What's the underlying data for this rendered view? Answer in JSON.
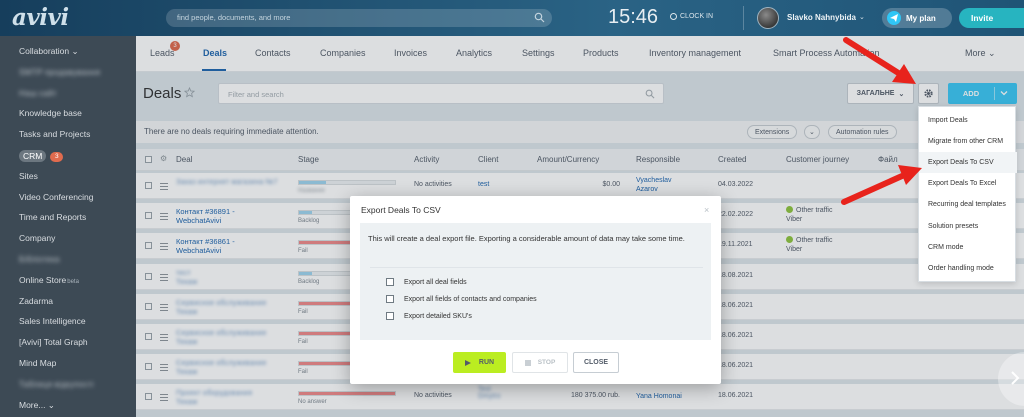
{
  "topbar": {
    "logo": "avivi",
    "search_placeholder": "find people, documents, and more",
    "clock": "15:46",
    "clock_in": "CLOCK IN",
    "username": "Slavko Nahnybida",
    "my_plan": "My plan",
    "invite": "Invite"
  },
  "sidebar": {
    "items": [
      {
        "label": "Collaboration ⌄",
        "blur": false
      },
      {
        "label": "SMTP продавування",
        "blur": true
      },
      {
        "label": "Наш сайт",
        "blur": true
      },
      {
        "label": "Knowledge base",
        "blur": false
      },
      {
        "label": "Tasks and Projects",
        "blur": false
      },
      {
        "label": "CRM",
        "badge": "3",
        "blur": false
      },
      {
        "label": "Sites",
        "blur": false
      },
      {
        "label": "Video Conferencing",
        "blur": false
      },
      {
        "label": "Time and Reports",
        "blur": false
      },
      {
        "label": "Company",
        "blur": false
      },
      {
        "label": "Бібліотека",
        "blur": true
      },
      {
        "label": "Online Store",
        "sup": "beta",
        "blur": false
      },
      {
        "label": "Zadarma",
        "blur": false
      },
      {
        "label": "Sales Intelligence",
        "blur": false
      },
      {
        "label": "[Avivi] Total Graph",
        "blur": false
      },
      {
        "label": "Mind Map",
        "blur": false
      },
      {
        "label": "Таблиця відкупості",
        "blur": true
      },
      {
        "label": "More... ⌄",
        "blur": false
      }
    ]
  },
  "tabs": {
    "items": [
      "Leads",
      "Deals",
      "Contacts",
      "Companies",
      "Invoices",
      "Analytics",
      "Settings",
      "Products",
      "Inventory management",
      "Smart Process Automation",
      "More ⌄"
    ],
    "leads_badge": "3"
  },
  "toolbar": {
    "title": "Deals",
    "filter_placeholder": "Filter and search",
    "category_button": "ЗАГАЛЬНЕ",
    "add_button": "ADD"
  },
  "infobar": {
    "message": "There are no deals requiring immediate attention.",
    "extensions": "Extensions",
    "automation_rules": "Automation rules"
  },
  "table": {
    "headers": [
      "Deal",
      "Stage",
      "Activity",
      "Client",
      "Amount/Currency",
      "Responsible",
      "Created",
      "Customer journey",
      "Файл"
    ],
    "rows": [
      {
        "deal": "Заказ интернет магазина №7",
        "deal_blur": true,
        "stage_color": "#9fd4ef",
        "stage_pct": 0.28,
        "stage_label": "Название",
        "stage_blur": true,
        "activity": "No activities",
        "client": "test",
        "client_blur": false,
        "amount": "$0.00",
        "responsible": "Vyacheslav\nAzarov",
        "responsible_blur": false,
        "created": "04.03.2022",
        "journey": ""
      },
      {
        "deal": "Контакт #36891 -\nWebchatAvivi",
        "deal_blur": false,
        "stage_color": "#9fd4ef",
        "stage_pct": 0.14,
        "stage_label": "Backlog",
        "stage_blur": false,
        "activity": "",
        "client": "",
        "client_blur": false,
        "amount": "",
        "responsible": "",
        "responsible_blur": false,
        "created": "22.02.2022",
        "journey": "Other traffic\nViber"
      },
      {
        "deal": "Контакт #36861 -\nWebchatAvivi",
        "deal_blur": false,
        "stage_color": "#f08a8a",
        "stage_pct": 1.0,
        "stage_label": "Fail",
        "stage_blur": false,
        "activity": "",
        "client": "",
        "client_blur": false,
        "amount": "",
        "responsible": "",
        "responsible_blur": false,
        "created": "19.11.2021",
        "journey": "Other traffic\nViber"
      },
      {
        "deal": "тест\nТекам",
        "deal_blur": true,
        "stage_color": "#9fd4ef",
        "stage_pct": 0.14,
        "stage_label": "Backlog",
        "stage_blur": false,
        "activity": "",
        "client": "",
        "client_blur": false,
        "amount": "",
        "responsible": "",
        "responsible_blur": false,
        "created": "18.08.2021",
        "journey": ""
      },
      {
        "deal": "Сервисное обслуживание\nТекам",
        "deal_blur": true,
        "stage_color": "#f08a8a",
        "stage_pct": 1.0,
        "stage_label": "Fail",
        "stage_blur": false,
        "activity": "",
        "client": "",
        "client_blur": false,
        "amount": "",
        "responsible": "",
        "responsible_blur": false,
        "created": "18.06.2021",
        "journey": ""
      },
      {
        "deal": "Сервисное обслуживание\nТекам",
        "deal_blur": true,
        "stage_color": "#f08a8a",
        "stage_pct": 1.0,
        "stage_label": "Fail",
        "stage_blur": false,
        "activity": "",
        "client": "",
        "client_blur": false,
        "amount": "",
        "responsible": "",
        "responsible_blur": false,
        "created": "18.06.2021",
        "journey": ""
      },
      {
        "deal": "Сервисное обслуживание\nТекам",
        "deal_blur": true,
        "stage_color": "#f08a8a",
        "stage_pct": 1.0,
        "stage_label": "Fail",
        "stage_blur": false,
        "activity": "",
        "client": "",
        "client_blur": false,
        "amount": "",
        "responsible": "",
        "responsible_blur": false,
        "created": "18.06.2021",
        "journey": ""
      },
      {
        "deal": "Проект оборудования\nТекам",
        "deal_blur": true,
        "stage_color": "#f08a8a",
        "stage_pct": 1.0,
        "stage_label": "No answer",
        "stage_blur": false,
        "activity": "No activities",
        "client": "Test\nDmytro",
        "client_blur": true,
        "amount": "180 375.00 rub.",
        "responsible": "Yana Homonai",
        "responsible_blur": false,
        "created": "18.06.2021",
        "journey": ""
      }
    ]
  },
  "dropdown": {
    "items": [
      "Import Deals",
      "Migrate from other CRM",
      "Export Deals To CSV",
      "Export Deals To Excel",
      "Recurring deal templates",
      "Solution presets",
      "CRM mode",
      "Order handling mode"
    ]
  },
  "modal": {
    "title": "Export Deals To CSV",
    "description": "This will create a deal export file. Exporting a considerable amount of data may take some time.",
    "options": [
      "Export all deal fields",
      "Export all fields of contacts and companies",
      "Export detailed SKU's"
    ],
    "run": "RUN",
    "stop": "STOP",
    "close": "CLOSE"
  },
  "colors": {
    "accent": "#2067b0",
    "add": "#3bc8f5",
    "run": "#bbed21",
    "arrow": "#e8231c"
  }
}
